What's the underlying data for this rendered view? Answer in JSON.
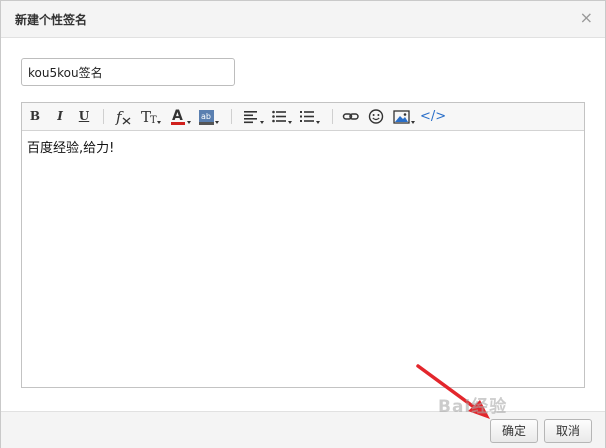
{
  "dialog": {
    "title": "新建个性签名",
    "close_symbol": "×"
  },
  "name_field": {
    "value": "kou5kou签名"
  },
  "toolbar": {
    "bold": "B",
    "italic": "I",
    "underline": "U",
    "icons": [
      "bold-icon",
      "italic-icon",
      "underline-icon",
      "clear-format-icon",
      "font-size-icon",
      "font-color-icon",
      "background-color-icon",
      "align-icon",
      "unordered-list-icon",
      "ordered-list-icon",
      "link-icon",
      "emoji-icon",
      "image-icon",
      "html-source-icon"
    ],
    "html_source": "</>"
  },
  "editor": {
    "content": "百度经验,给力!"
  },
  "footer": {
    "confirm_label": "确定",
    "cancel_label": "取消"
  },
  "watermark": "Bai经验",
  "colors": {
    "arrow": "#e3262c",
    "font_color_bar": "#d0201c",
    "link_blue": "#2a6fc9"
  }
}
